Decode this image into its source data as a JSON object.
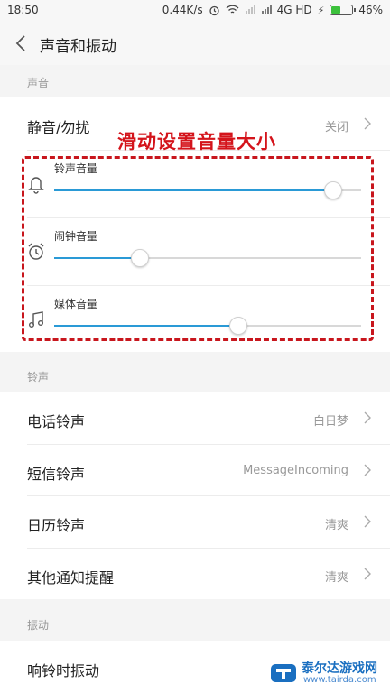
{
  "status_bar": {
    "time": "18:50",
    "speed": "0.44K/s",
    "network": "4G HD",
    "battery": "46%",
    "battery_level": 0.46
  },
  "header": {
    "title": "声音和振动"
  },
  "sections": {
    "sound": "声音",
    "ringtone": "铃声",
    "vibration": "振动"
  },
  "mute_row": {
    "label": "静音/勿扰",
    "value": "关闭"
  },
  "volumes": [
    {
      "label": "铃声音量",
      "icon": "bell-icon",
      "level": 0.91
    },
    {
      "label": "闹钟音量",
      "icon": "alarm-clock-icon",
      "level": 0.28
    },
    {
      "label": "媒体音量",
      "icon": "music-note-icon",
      "level": 0.6
    }
  ],
  "ringtones": [
    {
      "label": "电话铃声",
      "value": "白日梦"
    },
    {
      "label": "短信铃声",
      "value": "MessageIncoming"
    },
    {
      "label": "日历铃声",
      "value": "清爽"
    },
    {
      "label": "其他通知提醒",
      "value": "清爽"
    }
  ],
  "vibration_row": {
    "label": "响铃时振动"
  },
  "annotation": {
    "text": "滑动设置音量大小",
    "color": "#d4141b"
  },
  "watermark": {
    "title": "泰尔达游戏网",
    "url": "www.tairda.com"
  },
  "colors": {
    "accent": "#2a9ad6",
    "annotation": "#c8161d"
  }
}
